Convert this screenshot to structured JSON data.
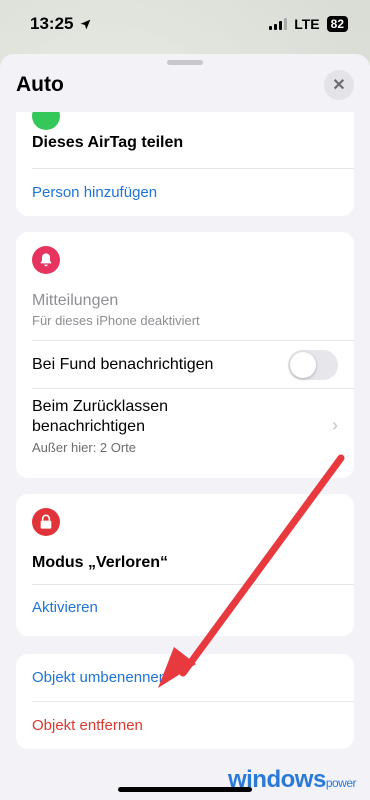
{
  "status_bar": {
    "time": "13:25",
    "network": "LTE",
    "battery": "82"
  },
  "sheet": {
    "title": "Auto"
  },
  "share_section": {
    "title": "Dieses AirTag teilen",
    "add_person": "Person hinzufügen"
  },
  "notifications_section": {
    "title": "Mitteilungen",
    "subtitle": "Für dieses iPhone deaktiviert",
    "notify_found_label": "Bei Fund benachrichtigen",
    "notify_found_enabled": false,
    "left_behind_label": "Beim Zurücklassen benachrichtigen",
    "left_behind_sub": "Außer hier: 2 Orte"
  },
  "lost_section": {
    "title": "Modus „Verloren“",
    "activate": "Aktivieren"
  },
  "object_section": {
    "rename": "Objekt umbenennen",
    "remove": "Objekt entfernen"
  },
  "watermark": {
    "brand": "windows",
    "suffix": "power"
  },
  "colors": {
    "accent_blue": "#1f74d6",
    "destructive_red": "#d93a30",
    "notification_icon": "#e6345f",
    "lost_icon": "#e0343a",
    "annotation_arrow": "#e8393f"
  }
}
